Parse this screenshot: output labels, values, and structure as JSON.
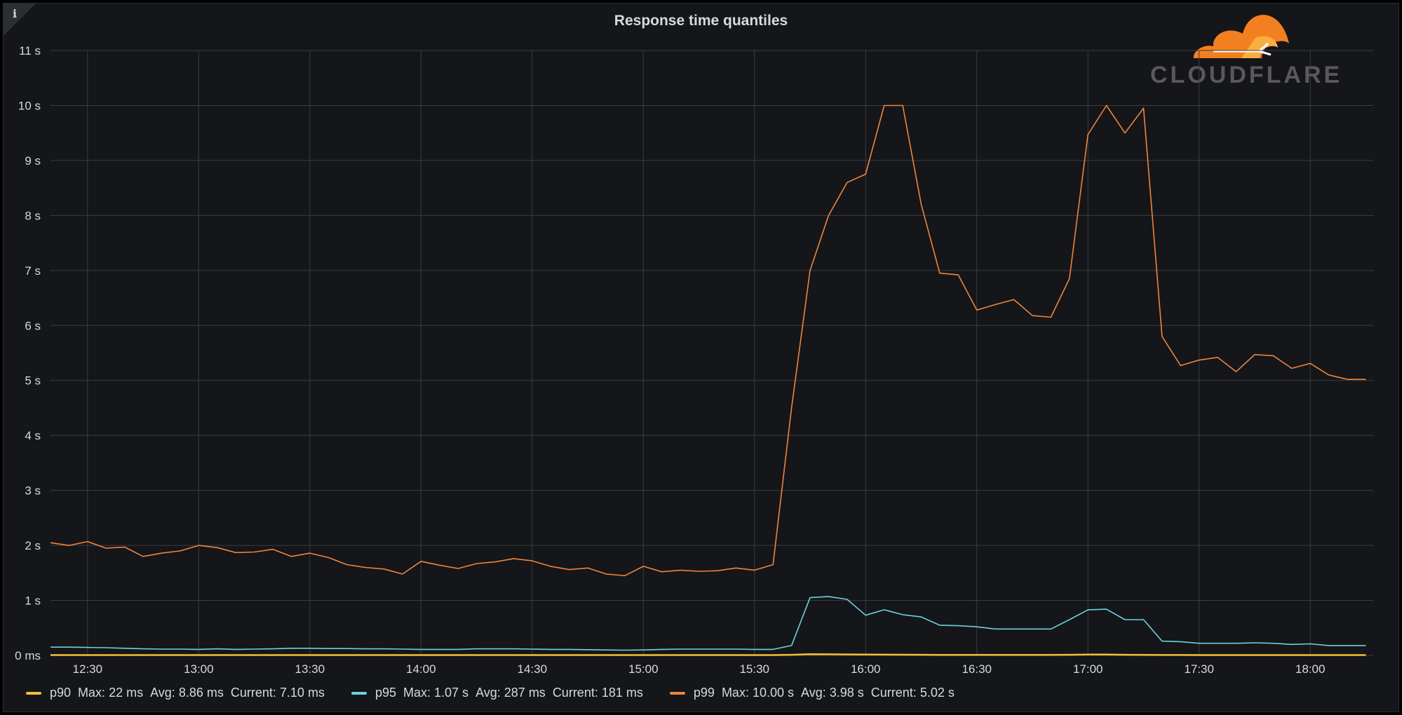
{
  "panel": {
    "title": "Response time quantiles",
    "info_glyph": "i",
    "info_icon": "info-icon"
  },
  "brand": {
    "name": "CLOUDFLARE",
    "icon": "cloud-logo-icon",
    "colors": {
      "cloud_primary": "#f38020",
      "cloud_secondary": "#faae40",
      "wordmark": "#595959"
    }
  },
  "legend": [
    {
      "name": "p90",
      "max_label": "Max:",
      "max": "22 ms",
      "avg_label": "Avg:",
      "avg": "8.86 ms",
      "current_label": "Current:",
      "current": "7.10 ms",
      "color": "#f2c037"
    },
    {
      "name": "p95",
      "max_label": "Max:",
      "max": "1.07 s",
      "avg_label": "Avg:",
      "avg": "287 ms",
      "current_label": "Current:",
      "current": "181 ms",
      "color": "#6ed0e0"
    },
    {
      "name": "p99",
      "max_label": "Max:",
      "max": "10.00 s",
      "avg_label": "Avg:",
      "avg": "3.98 s",
      "current_label": "Current:",
      "current": "5.02 s",
      "color": "#ef843c"
    }
  ],
  "chart_data": {
    "type": "line",
    "title": "Response time quantiles",
    "xlabel": "",
    "ylabel": "",
    "grid": true,
    "legend_position": "bottom",
    "x": [
      "12:20",
      "12:25",
      "12:30",
      "12:35",
      "12:40",
      "12:45",
      "12:50",
      "12:55",
      "13:00",
      "13:05",
      "13:10",
      "13:15",
      "13:20",
      "13:25",
      "13:30",
      "13:35",
      "13:40",
      "13:45",
      "13:50",
      "13:55",
      "14:00",
      "14:05",
      "14:10",
      "14:15",
      "14:20",
      "14:25",
      "14:30",
      "14:35",
      "14:40",
      "14:45",
      "14:50",
      "14:55",
      "15:00",
      "15:05",
      "15:10",
      "15:15",
      "15:20",
      "15:25",
      "15:30",
      "15:35",
      "15:40",
      "15:45",
      "15:50",
      "15:55",
      "16:00",
      "16:05",
      "16:10",
      "16:15",
      "16:20",
      "16:25",
      "16:30",
      "16:35",
      "16:40",
      "16:45",
      "16:50",
      "16:55",
      "17:00",
      "17:05",
      "17:10",
      "17:15",
      "17:20",
      "17:25",
      "17:30",
      "17:35",
      "17:40",
      "17:45",
      "17:50",
      "17:55",
      "18:00",
      "18:05",
      "18:10",
      "18:15"
    ],
    "x_ticks": [
      "12:30",
      "13:00",
      "13:30",
      "14:00",
      "14:30",
      "15:00",
      "15:30",
      "16:00",
      "16:30",
      "17:00",
      "17:30",
      "18:00"
    ],
    "x_range": [
      "12:20",
      "18:17"
    ],
    "y_ticks": [
      {
        "value": 0,
        "label": "0 ms"
      },
      {
        "value": 1,
        "label": "1 s"
      },
      {
        "value": 2,
        "label": "2 s"
      },
      {
        "value": 3,
        "label": "3 s"
      },
      {
        "value": 4,
        "label": "4 s"
      },
      {
        "value": 5,
        "label": "5 s"
      },
      {
        "value": 6,
        "label": "6 s"
      },
      {
        "value": 7,
        "label": "7 s"
      },
      {
        "value": 8,
        "label": "8 s"
      },
      {
        "value": 9,
        "label": "9 s"
      },
      {
        "value": 10,
        "label": "10 s"
      },
      {
        "value": 11,
        "label": "11 s"
      }
    ],
    "ylim": [
      0,
      11
    ],
    "y_unit": "s",
    "series": [
      {
        "name": "p90",
        "color": "#f2c037",
        "values": [
          0.007,
          0.007,
          0.007,
          0.007,
          0.007,
          0.007,
          0.007,
          0.007,
          0.007,
          0.007,
          0.007,
          0.007,
          0.007,
          0.007,
          0.007,
          0.007,
          0.007,
          0.007,
          0.007,
          0.007,
          0.007,
          0.007,
          0.007,
          0.007,
          0.007,
          0.007,
          0.007,
          0.007,
          0.007,
          0.007,
          0.007,
          0.007,
          0.007,
          0.007,
          0.007,
          0.007,
          0.007,
          0.007,
          0.007,
          0.007,
          0.012,
          0.022,
          0.02,
          0.018,
          0.015,
          0.014,
          0.013,
          0.012,
          0.01,
          0.01,
          0.009,
          0.009,
          0.009,
          0.009,
          0.01,
          0.012,
          0.015,
          0.015,
          0.012,
          0.01,
          0.008,
          0.008,
          0.007,
          0.007,
          0.007,
          0.007,
          0.007,
          0.007,
          0.007,
          0.007,
          0.007,
          0.007
        ]
      },
      {
        "name": "p95",
        "color": "#6ed0e0",
        "values": [
          0.15,
          0.15,
          0.145,
          0.14,
          0.13,
          0.12,
          0.115,
          0.115,
          0.11,
          0.12,
          0.11,
          0.115,
          0.12,
          0.13,
          0.13,
          0.125,
          0.125,
          0.12,
          0.12,
          0.115,
          0.11,
          0.11,
          0.11,
          0.12,
          0.12,
          0.12,
          0.115,
          0.11,
          0.11,
          0.105,
          0.1,
          0.095,
          0.1,
          0.11,
          0.115,
          0.115,
          0.115,
          0.115,
          0.11,
          0.11,
          0.18,
          1.05,
          1.07,
          1.02,
          0.73,
          0.83,
          0.74,
          0.7,
          0.55,
          0.54,
          0.52,
          0.48,
          0.48,
          0.48,
          0.48,
          0.65,
          0.83,
          0.84,
          0.65,
          0.65,
          0.26,
          0.25,
          0.22,
          0.22,
          0.22,
          0.23,
          0.22,
          0.2,
          0.21,
          0.18,
          0.18,
          0.18
        ]
      },
      {
        "name": "p99",
        "color": "#ef843c",
        "values": [
          2.05,
          2.0,
          2.07,
          1.95,
          1.97,
          1.8,
          1.86,
          1.9,
          2.0,
          1.96,
          1.87,
          1.88,
          1.93,
          1.8,
          1.86,
          1.78,
          1.65,
          1.6,
          1.57,
          1.48,
          1.71,
          1.64,
          1.58,
          1.67,
          1.7,
          1.76,
          1.72,
          1.62,
          1.56,
          1.59,
          1.48,
          1.45,
          1.62,
          1.52,
          1.55,
          1.53,
          1.54,
          1.59,
          1.55,
          1.65,
          4.5,
          7.0,
          8.0,
          8.6,
          8.75,
          10.0,
          10.0,
          8.2,
          6.95,
          6.92,
          6.28,
          6.38,
          6.47,
          6.18,
          6.15,
          6.85,
          9.47,
          10.0,
          9.5,
          9.95,
          5.8,
          5.27,
          5.37,
          5.42,
          5.16,
          5.47,
          5.45,
          5.22,
          5.31,
          5.1,
          5.02,
          5.02
        ]
      }
    ]
  }
}
